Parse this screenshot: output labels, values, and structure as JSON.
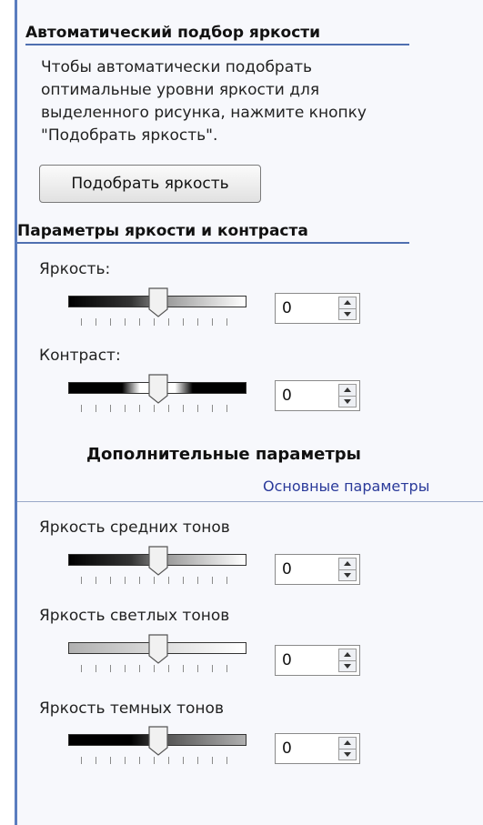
{
  "auto": {
    "title": "Автоматический подбор яркости",
    "description": "Чтобы автоматически подобрать оптимальные уровни яркости для выделенного рисунка, нажмите кнопку \"Подобрать яркость\".",
    "button": "Подобрать яркость"
  },
  "params": {
    "title": "Параметры яркости и контраста",
    "brightness": {
      "label": "Яркость:",
      "value": "0"
    },
    "contrast": {
      "label": "Контраст:",
      "value": "0"
    }
  },
  "advanced": {
    "title": "Дополнительные параметры",
    "link": "Основные параметры"
  },
  "tones": {
    "midtones": {
      "label": "Яркость средних тонов",
      "value": "0"
    },
    "highlights": {
      "label": "Яркость светлых тонов",
      "value": "0"
    },
    "shadows": {
      "label": "Яркость темных тонов",
      "value": "0"
    }
  }
}
